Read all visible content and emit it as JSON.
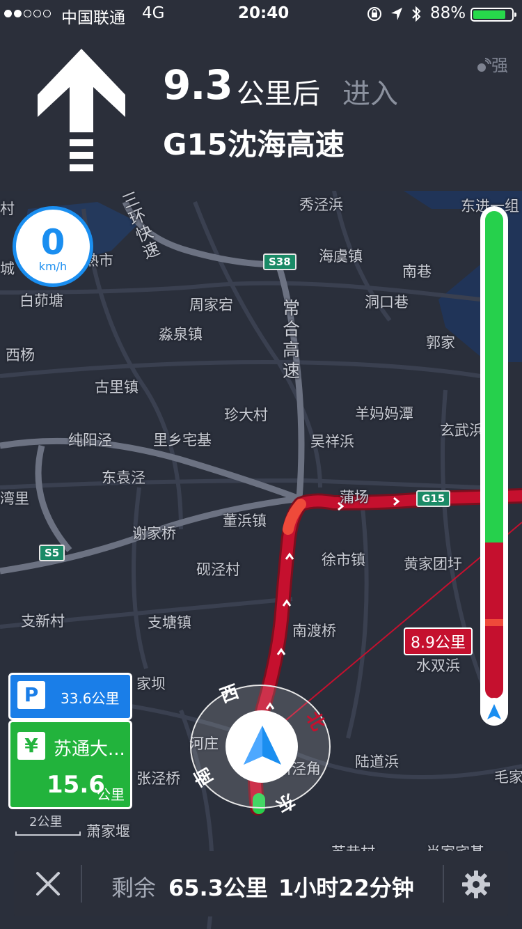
{
  "status": {
    "carrier": "中国联通",
    "network": "4G",
    "time": "20:40",
    "battery": "88%",
    "signal_bars": 2
  },
  "nav": {
    "distance": "9.3",
    "distance_unit": "公里后",
    "action": "进入",
    "road": "G15沈海高速",
    "gps": "强",
    "turn_icon": "straight-arrow-icon"
  },
  "speed": {
    "value": "0",
    "unit": "km/h"
  },
  "map": {
    "labels": [
      {
        "text": "秀泾浜"
      },
      {
        "text": "东进一组"
      },
      {
        "text": "村"
      },
      {
        "text": "三环快速"
      },
      {
        "text": "常熟市"
      },
      {
        "text": "海虞镇"
      },
      {
        "text": "南巷"
      },
      {
        "text": "城"
      },
      {
        "text": "白茆塘"
      },
      {
        "text": "周家宕"
      },
      {
        "text": "洞口巷"
      },
      {
        "text": "常合高速"
      },
      {
        "text": "淼泉镇"
      },
      {
        "text": "郭家"
      },
      {
        "text": "西杨"
      },
      {
        "text": "古里镇"
      },
      {
        "text": "珍大村"
      },
      {
        "text": "羊妈妈潭"
      },
      {
        "text": "玄武浜"
      },
      {
        "text": "纯阳泾"
      },
      {
        "text": "里乡宅基"
      },
      {
        "text": "吴祥浜"
      },
      {
        "text": "东袁泾"
      },
      {
        "text": "湾里"
      },
      {
        "text": "蒲场"
      },
      {
        "text": "董浜镇"
      },
      {
        "text": "谢家桥"
      },
      {
        "text": "徐市镇"
      },
      {
        "text": "黄家团圩"
      },
      {
        "text": "砚泾村"
      },
      {
        "text": "支新村"
      },
      {
        "text": "支塘镇"
      },
      {
        "text": "南渡桥"
      },
      {
        "text": "水双浜"
      },
      {
        "text": "家坝"
      },
      {
        "text": "河庄"
      },
      {
        "text": "新泾角"
      },
      {
        "text": "陆道浜"
      },
      {
        "text": "毛家"
      },
      {
        "text": "张泾桥"
      },
      {
        "text": "萧家堰"
      },
      {
        "text": "苏巷村"
      },
      {
        "text": "肖家宅基"
      }
    ],
    "highways": [
      {
        "text": "S38"
      },
      {
        "text": "G15"
      },
      {
        "text": "S5"
      }
    ],
    "route_distance_tag": "8.9公里",
    "compass": {
      "north": "北",
      "east": "东",
      "south": "南",
      "west": "西"
    },
    "route_progress": 0.68,
    "scale": "2公里"
  },
  "parking": {
    "distance": "33.6公里"
  },
  "toll": {
    "name": "苏通大...",
    "distance": "15.6",
    "unit": "公里"
  },
  "bottom": {
    "remain_label": "剩余",
    "remain_distance": "65.3公里",
    "remain_time": "1小时22分钟"
  },
  "colors": {
    "accent_blue": "#1a8ef0",
    "congestion_red": "#c5102e",
    "clear_green": "#26d04c"
  }
}
